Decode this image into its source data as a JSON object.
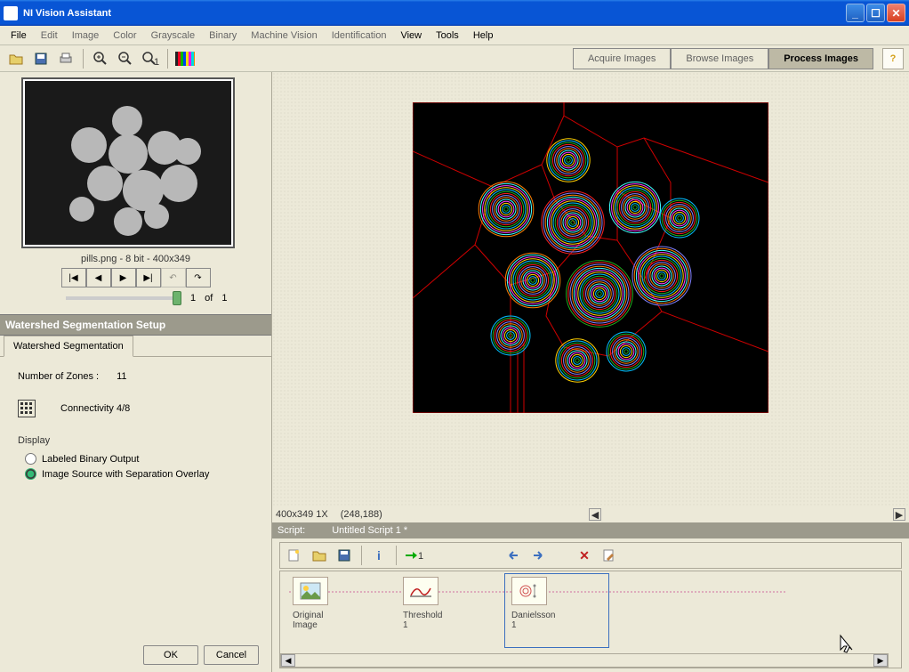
{
  "window": {
    "title": "NI Vision Assistant"
  },
  "menu": [
    "File",
    "Edit",
    "Image",
    "Color",
    "Grayscale",
    "Binary",
    "Machine Vision",
    "Identification",
    "View",
    "Tools",
    "Help"
  ],
  "menu_dark": [
    "File",
    "View",
    "Tools",
    "Help"
  ],
  "modes": {
    "acquire": "Acquire Images",
    "browse": "Browse Images",
    "process": "Process Images"
  },
  "thumbnail": {
    "caption": "pills.png - 8 bit - 400x349",
    "page_current": "1",
    "page_sep": "of",
    "page_total": "1"
  },
  "setup": {
    "header": "Watershed Segmentation Setup",
    "tab": "Watershed Segmentation",
    "zones_label": "Number of Zones :",
    "zones_value": "11",
    "connectivity": "Connectivity 4/8",
    "display_label": "Display",
    "radio1": "Labeled Binary Output",
    "radio2": "Image Source with Separation Overlay",
    "ok": "OK",
    "cancel": "Cancel"
  },
  "canvas": {
    "dims": "400x349 1X",
    "coords": "(248,188)"
  },
  "script": {
    "label": "Script:",
    "name": "Untitled Script 1 *",
    "steps": [
      {
        "label": "Original Image"
      },
      {
        "label": "Threshold 1"
      },
      {
        "label": "Danielsson 1"
      }
    ]
  },
  "help_glyph": "?",
  "ring_colors": [
    "#ff2020",
    "#20b020",
    "#00c0ff",
    "#ffd000",
    "#ff40ff",
    "#40ffff",
    "#ff8000",
    "#8080ff"
  ]
}
